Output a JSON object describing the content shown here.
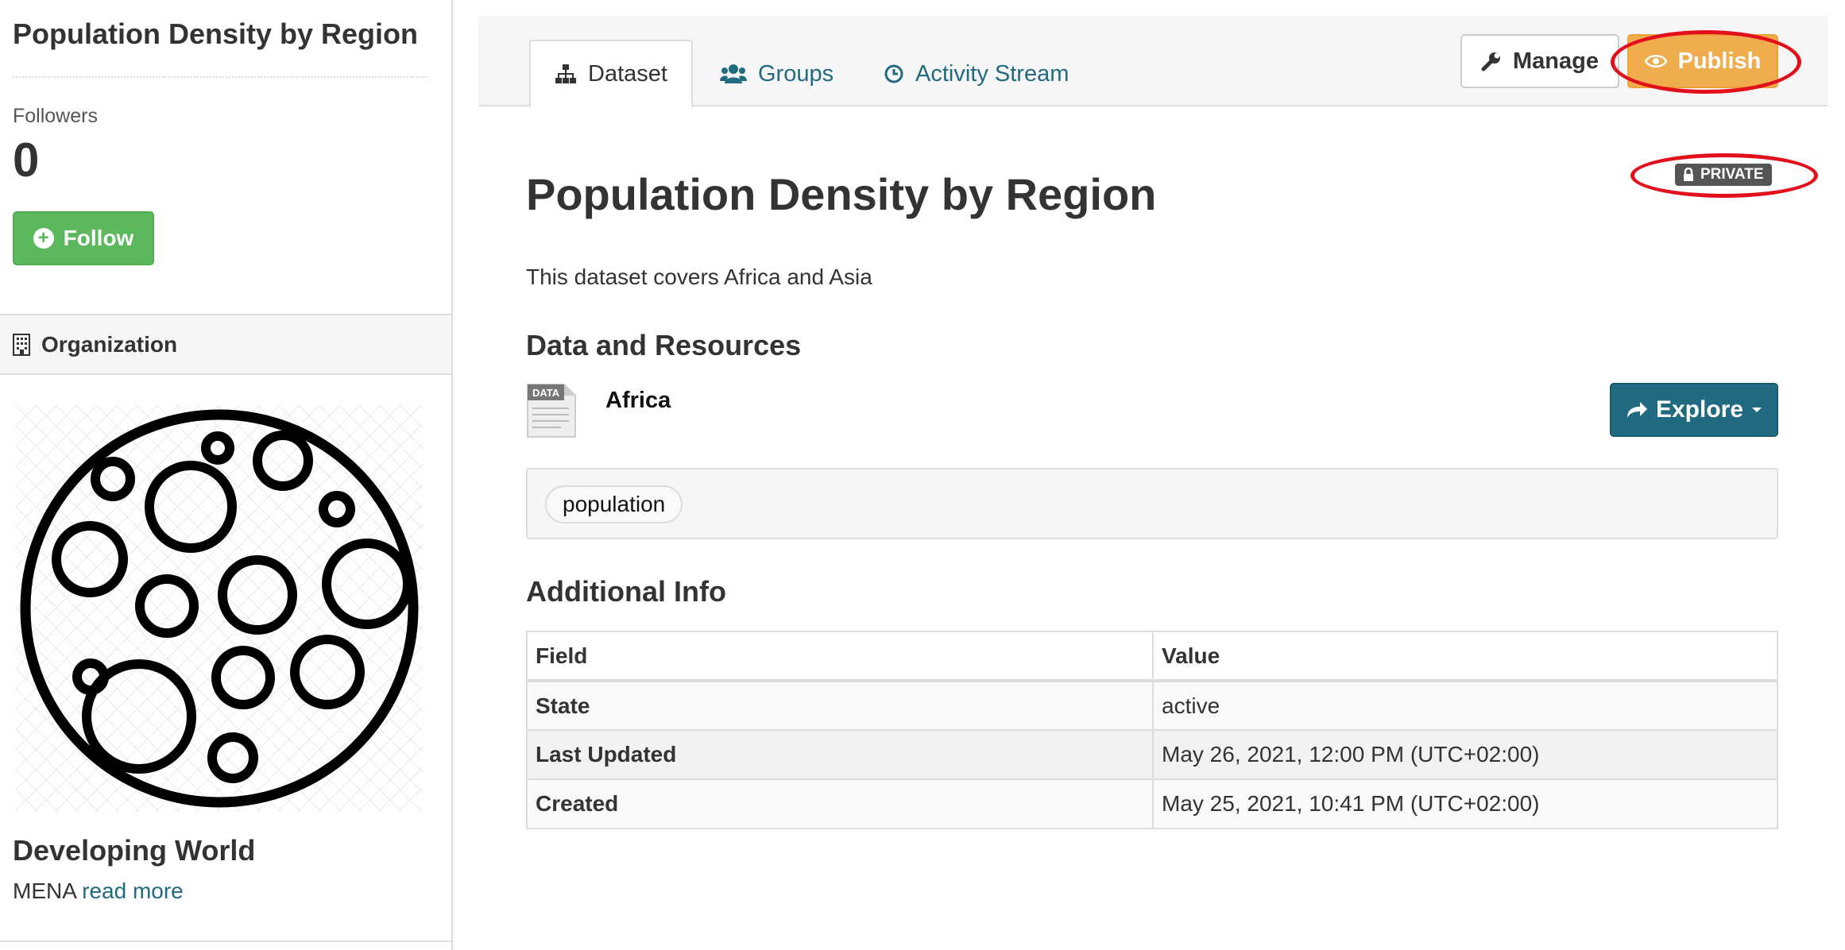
{
  "sidebar": {
    "title": "Population Density by Region",
    "followers_label": "Followers",
    "followers_count": "0",
    "follow_label": "Follow",
    "organization_label": "Organization",
    "org_name": "Developing World",
    "org_desc": "MENA",
    "read_more": "read more"
  },
  "tabs": [
    {
      "label": "Dataset",
      "icon": "sitemap-icon"
    },
    {
      "label": "Groups",
      "icon": "users-icon"
    },
    {
      "label": "Activity Stream",
      "icon": "clock-icon"
    }
  ],
  "actions": {
    "manage_label": "Manage",
    "publish_label": "Publish"
  },
  "dataset": {
    "private_badge": "PRIVATE",
    "title": "Population Density by Region",
    "description": "This dataset covers Africa and Asia",
    "resources_heading": "Data and Resources",
    "resources": [
      {
        "name": "Africa",
        "icon_text": "DATA",
        "explore_label": "Explore"
      }
    ],
    "tags": [
      "population"
    ],
    "additional_heading": "Additional Info",
    "table": {
      "headers": [
        "Field",
        "Value"
      ],
      "rows": [
        {
          "field": "State",
          "value": "active"
        },
        {
          "field": "Last Updated",
          "value": "May 26, 2021, 12:00 PM (UTC+02:00)"
        },
        {
          "field": "Created",
          "value": "May 25, 2021, 10:41 PM (UTC+02:00)"
        }
      ]
    }
  },
  "colors": {
    "link": "#206b82",
    "follow": "#5cb85c",
    "publish": "#f0ad4e",
    "explore": "#206b82",
    "annotation": "#e3101c"
  }
}
